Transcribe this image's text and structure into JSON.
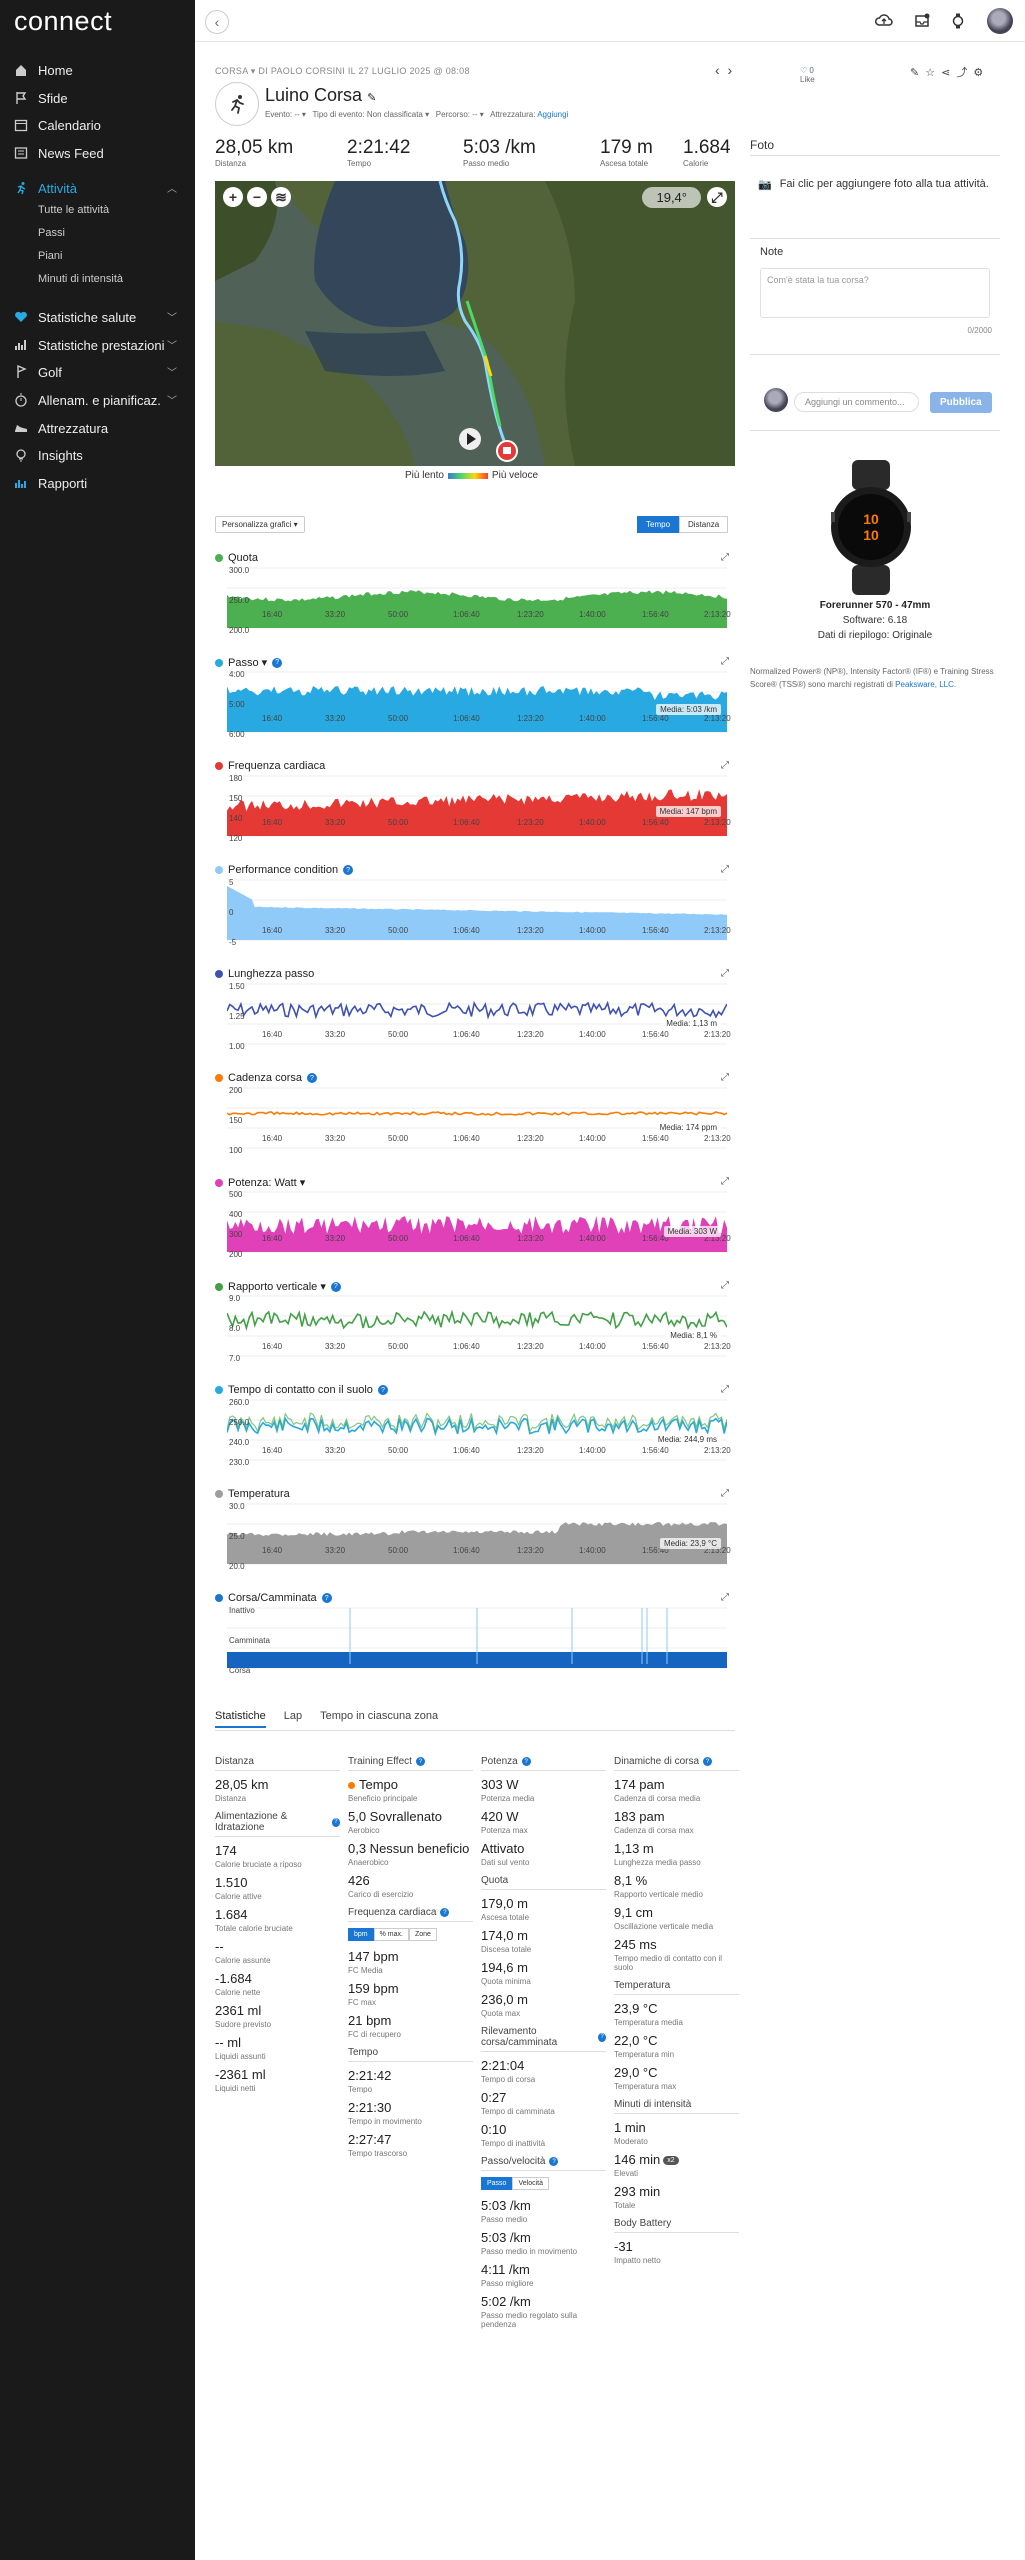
{
  "sidebar": {
    "logo": "connect",
    "items": [
      {
        "label": "Home",
        "icon": "home-icon"
      },
      {
        "label": "Sfide",
        "icon": "flag-icon"
      },
      {
        "label": "Calendario",
        "icon": "calendar-icon"
      },
      {
        "label": "News Feed",
        "icon": "feed-icon"
      },
      {
        "label": "Attività",
        "icon": "run-icon"
      },
      {
        "label": "Statistiche salute",
        "icon": "heart-icon"
      },
      {
        "label": "Statistiche prestazioni",
        "icon": "chart-icon"
      },
      {
        "label": "Golf",
        "icon": "golf-icon"
      },
      {
        "label": "Allenam. e pianificaz.",
        "icon": "stopwatch-icon"
      },
      {
        "label": "Attrezzatura",
        "icon": "shoe-icon"
      },
      {
        "label": "Insights",
        "icon": "bulb-icon"
      },
      {
        "label": "Rapporti",
        "icon": "report-icon"
      }
    ],
    "sub_items": [
      "Tutte le attività",
      "Passi",
      "Piani",
      "Minuti di intensità"
    ]
  },
  "activity": {
    "meta": "CORSA ▾ DI PAOLO CORSINI IL 27 LUGLIO 2025 @ 08:08",
    "title": "Luino Corsa",
    "evento": "Evento: -- ▾",
    "tipo_evento": "Tipo di evento: Non classificata ▾",
    "percorso": "Percorso: -- ▾",
    "attrezzatura_label": "Attrezzatura:",
    "attrezzatura_link": "Aggiungi",
    "like": "0 Like",
    "top_stats": [
      {
        "value": "28,05 km",
        "label": "Distanza"
      },
      {
        "value": "2:21:42",
        "label": "Tempo"
      },
      {
        "value": "5:03 /km",
        "label": "Passo medio"
      },
      {
        "value": "179 m",
        "label": "Ascesa totale"
      },
      {
        "value": "1.684",
        "label": "Calorie"
      }
    ]
  },
  "map": {
    "angle": "19,4°",
    "legend_slow": "Più lento",
    "legend_fast": "Più veloce"
  },
  "controls": {
    "customize": "Personalizza grafici ▾",
    "time": "Tempo",
    "distance": "Distanza"
  },
  "x_ticks": [
    "16:40",
    "33:20",
    "50:00",
    "1:06:40",
    "1:23:20",
    "1:40:00",
    "1:56:40",
    "2:13:20"
  ],
  "charts": [
    {
      "title": "Quota",
      "color": "#4caf50",
      "y_ticks": [
        "300.0",
        "250.0",
        "200.0"
      ],
      "avg": ""
    },
    {
      "title": "Passo ▾",
      "color": "#29a9e1",
      "y_ticks": [
        "4:00",
        "5:00",
        "6:00"
      ],
      "avg": "Media: 5:03 /km"
    },
    {
      "title": "Frequenza cardiaca",
      "color": "#e53935",
      "y_ticks": [
        "180",
        "150",
        "140",
        "120"
      ],
      "avg": "Media: 147 bpm"
    },
    {
      "title": "Performance condition",
      "color": "#90caf9",
      "y_ticks": [
        "5",
        "0",
        "-5"
      ],
      "avg": ""
    },
    {
      "title": "Lunghezza passo",
      "color": "#3f51b5",
      "y_ticks": [
        "1.50",
        "1.25",
        "1.00"
      ],
      "avg": "Media: 1,13 m"
    },
    {
      "title": "Cadenza corsa",
      "color": "#ff7a00",
      "y_ticks": [
        "200",
        "150",
        "100"
      ],
      "avg": "Media: 174 ppm"
    },
    {
      "title": "Potenza: Watt ▾",
      "color": "#e040b8",
      "y_ticks": [
        "500",
        "400",
        "300",
        "200"
      ],
      "avg": "Media: 303 W"
    },
    {
      "title": "Rapporto verticale ▾",
      "color": "#43a047",
      "y_ticks": [
        "9.0",
        "8.0",
        "7.0"
      ],
      "avg": "Media: 8,1 %"
    },
    {
      "title": "Tempo di contatto con il suolo",
      "color": "#29a9e1",
      "y_ticks": [
        "260.0",
        "250.0",
        "240.0",
        "230.0"
      ],
      "avg": "Media: 244,9 ms"
    },
    {
      "title": "Temperatura",
      "color": "#9e9e9e",
      "y_ticks": [
        "30.0",
        "25.0",
        "20.0"
      ],
      "avg": "Media: 23,9 °C"
    },
    {
      "title": "Corsa/Camminata",
      "color": "#1976d2",
      "y_ticks": [
        "Inattivo",
        "Camminata",
        "Corsa"
      ],
      "avg": ""
    }
  ],
  "right": {
    "photo_title": "Foto",
    "photo_text": "Fai clic per aggiungere foto alla tua attività.",
    "note_title": "Note",
    "note_placeholder": "Com'è stata la tua corsa?",
    "note_counter": "0/2000",
    "comment_placeholder": "Aggiungi un commento...",
    "publish": "Pubblica",
    "device_name": "Forerunner 570 - 47mm",
    "software": "Software: 6.18",
    "summary": "Dati di riepilogo: Originale",
    "watch_time": "10:10",
    "trademark": "Normalized Power® (NP®), Intensity Factor® (IF®) e Training Stress Score® (TSS®) sono marchi registrati di ",
    "trademark_link": "Peaksware, LLC."
  },
  "stats_tabs": [
    "Statistiche",
    "Lap",
    "Tempo in ciascuna zona"
  ],
  "stats": {
    "distanza": {
      "h": "Distanza",
      "v": "28,05 km",
      "l": "Distanza"
    },
    "alim": {
      "h": "Alimentazione & Idratazione",
      "items": [
        {
          "v": "174",
          "l": "Calorie bruciate a riposo"
        },
        {
          "v": "1.510",
          "l": "Calorie attive"
        },
        {
          "v": "1.684",
          "l": "Totale calorie bruciate"
        },
        {
          "v": "--",
          "l": "Calorie assunte"
        },
        {
          "v": "-1.684",
          "l": "Calorie nette"
        },
        {
          "v": "2361 ml",
          "l": "Sudore previsto"
        },
        {
          "v": "-- ml",
          "l": "Liquidi assunti"
        },
        {
          "v": "-2361 ml",
          "l": "Liquidi netti"
        }
      ]
    },
    "te": {
      "h": "Training Effect",
      "items": [
        {
          "v": "Tempo",
          "l": "Beneficio principale"
        },
        {
          "v": "5,0 Sovrallenato",
          "l": "Aerobico"
        },
        {
          "v": "0,3 Nessun beneficio",
          "l": "Anaerobico"
        },
        {
          "v": "426",
          "l": "Carico di esercizio"
        }
      ]
    },
    "fc": {
      "h": "Frequenza cardiaca",
      "seg": [
        "bpm",
        "% max.",
        "Zone"
      ],
      "items": [
        {
          "v": "147 bpm",
          "l": "FC Media"
        },
        {
          "v": "159 bpm",
          "l": "FC max"
        },
        {
          "v": "21 bpm",
          "l": "FC di recupero"
        }
      ]
    },
    "tempo": {
      "h": "Tempo",
      "items": [
        {
          "v": "2:21:42",
          "l": "Tempo"
        },
        {
          "v": "2:21:30",
          "l": "Tempo in movimento"
        },
        {
          "v": "2:27:47",
          "l": "Tempo trascorso"
        }
      ]
    },
    "potenza": {
      "h": "Potenza",
      "items": [
        {
          "v": "303 W",
          "l": "Potenza media"
        },
        {
          "v": "420 W",
          "l": "Potenza max"
        },
        {
          "v": "Attivato",
          "l": "Dati sul vento"
        }
      ]
    },
    "quota": {
      "h": "Quota",
      "items": [
        {
          "v": "179,0 m",
          "l": "Ascesa totale"
        },
        {
          "v": "174,0 m",
          "l": "Discesa totale"
        },
        {
          "v": "194,6 m",
          "l": "Quota minima"
        },
        {
          "v": "236,0 m",
          "l": "Quota max"
        }
      ]
    },
    "rilev": {
      "h": "Rilevamento corsa/camminata",
      "items": [
        {
          "v": "2:21:04",
          "l": "Tempo di corsa"
        },
        {
          "v": "0:27",
          "l": "Tempo di camminata"
        },
        {
          "v": "0:10",
          "l": "Tempo di inattività"
        }
      ]
    },
    "passo": {
      "h": "Passo/velocità",
      "seg": [
        "Passo",
        "Velocità"
      ],
      "items": [
        {
          "v": "5:03 /km",
          "l": "Passo medio"
        },
        {
          "v": "5:03 /km",
          "l": "Passo medio in movimento"
        },
        {
          "v": "4:11 /km",
          "l": "Passo migliore"
        },
        {
          "v": "5:02 /km",
          "l": "Passo medio regolato sulla pendenza"
        }
      ]
    },
    "din": {
      "h": "Dinamiche di corsa",
      "items": [
        {
          "v": "174 pam",
          "l": "Cadenza di corsa media"
        },
        {
          "v": "183 pam",
          "l": "Cadenza di corsa max"
        },
        {
          "v": "1,13 m",
          "l": "Lunghezza media passo"
        },
        {
          "v": "8,1 %",
          "l": "Rapporto verticale medio"
        },
        {
          "v": "9,1 cm",
          "l": "Oscillazione verticale media"
        },
        {
          "v": "245 ms",
          "l": "Tempo medio di contatto con il suolo"
        }
      ]
    },
    "temp": {
      "h": "Temperatura",
      "items": [
        {
          "v": "23,9 °C",
          "l": "Temperatura media"
        },
        {
          "v": "22,0 °C",
          "l": "Temperatura min"
        },
        {
          "v": "29,0 °C",
          "l": "Temperatura max"
        }
      ]
    },
    "min": {
      "h": "Minuti di intensità",
      "items": [
        {
          "v": "1 min",
          "l": "Moderato"
        },
        {
          "v": "146 min",
          "l": "Elevati",
          "badge": "x2"
        },
        {
          "v": "293 min",
          "l": "Totale"
        }
      ]
    },
    "bb": {
      "h": "Body Battery",
      "items": [
        {
          "v": "-31",
          "l": "Impatto netto"
        }
      ]
    }
  }
}
